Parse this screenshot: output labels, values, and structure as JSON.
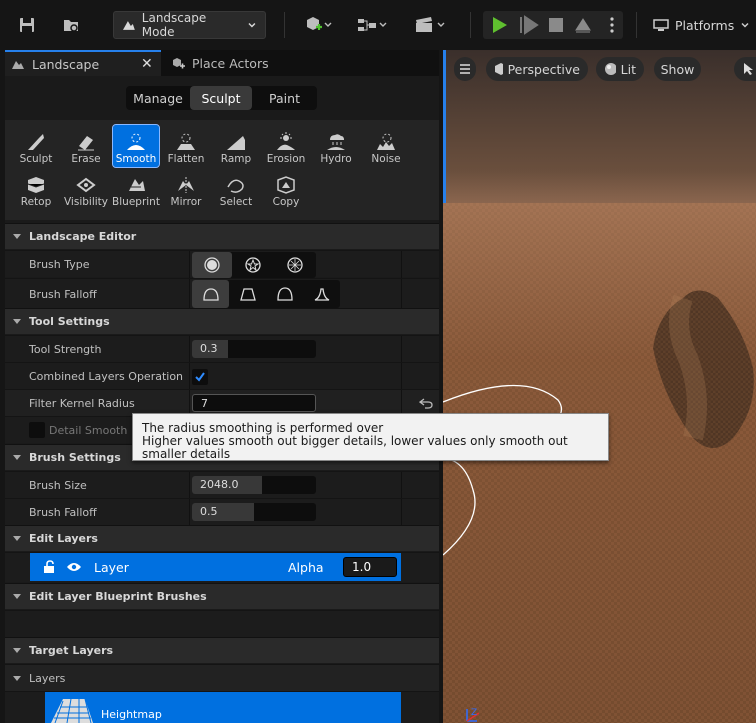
{
  "toolbar": {
    "mode_label": "Landscape Mode",
    "platforms_label": "Platforms"
  },
  "tabs": {
    "landscape": "Landscape",
    "place_actors": "Place Actors"
  },
  "mode_tabs": [
    "Manage",
    "Sculpt",
    "Paint"
  ],
  "tools_row1": [
    "Sculpt",
    "Erase",
    "Smooth",
    "Flatten",
    "Ramp",
    "Erosion",
    "Hydro",
    "Noise"
  ],
  "tools_row2": [
    "Retop",
    "Visibility",
    "Blueprint",
    "Mirror",
    "Select",
    "Copy"
  ],
  "active_tool": "Smooth",
  "sections": {
    "landscape_editor": "Landscape Editor",
    "tool_settings": "Tool Settings",
    "brush_settings": "Brush Settings",
    "edit_layers": "Edit Layers",
    "edit_layer_blueprint_brushes": "Edit Layer Blueprint Brushes",
    "target_layers": "Target Layers",
    "layers": "Layers"
  },
  "properties": {
    "brush_type": "Brush Type",
    "brush_falloff": "Brush Falloff",
    "tool_strength": "Tool Strength",
    "tool_strength_value": "0.3",
    "combined_layers_operation": "Combined Layers Operation",
    "filter_kernel_radius": "Filter Kernel Radius",
    "filter_kernel_radius_value": "7",
    "detail_smooth": "Detail Smooth",
    "brush_size": "Brush Size",
    "brush_size_value": "2048.0",
    "brush_falloff2": "Brush Falloff",
    "brush_falloff2_value": "0.5"
  },
  "edit_layers": {
    "layer_name": "Layer",
    "alpha_label": "Alpha",
    "alpha_value": "1.0"
  },
  "target_layers": {
    "heightmap": "Heightmap"
  },
  "viewport": {
    "perspective": "Perspective",
    "lit": "Lit",
    "show": "Show"
  },
  "tooltip": {
    "line1": "The radius smoothing is performed over",
    "line2": "Higher values smooth out bigger details, lower values only smooth out smaller details"
  },
  "colors": {
    "accent": "#0070e0",
    "play_green": "#5fbf2f"
  }
}
